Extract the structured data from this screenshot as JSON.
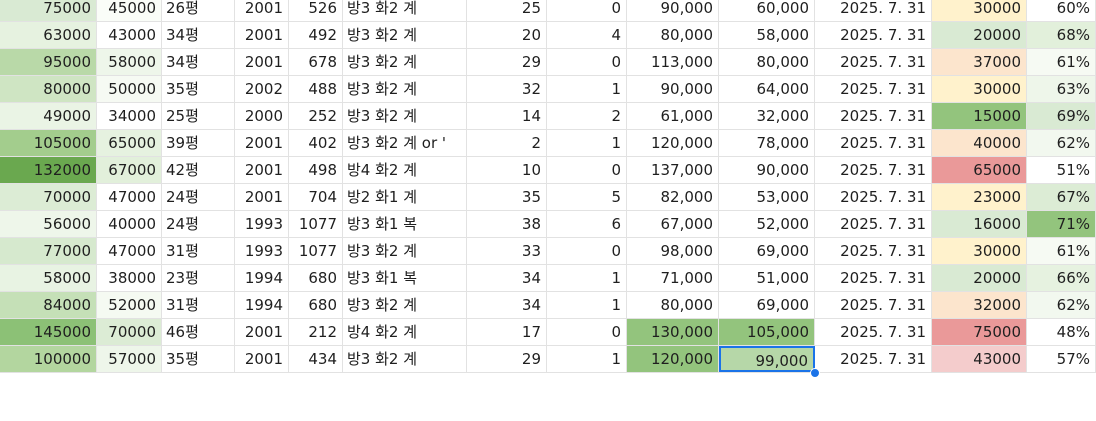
{
  "sheet": {
    "rows": [
      {
        "a": "75000",
        "b": "45000",
        "c": "26평",
        "d": "2001",
        "e": "526",
        "f": "방3 화2 계",
        "g": "25",
        "h": "0",
        "i": "90,000",
        "j": "60,000",
        "k": "2025. 7. 31",
        "l": "30000",
        "m": "60%"
      },
      {
        "a": "63000",
        "b": "43000",
        "c": "34평",
        "d": "2001",
        "e": "492",
        "f": "방3 화2 계",
        "g": "20",
        "h": "4",
        "i": "80,000",
        "j": "58,000",
        "k": "2025. 7. 31",
        "l": "20000",
        "m": "68%"
      },
      {
        "a": "95000",
        "b": "58000",
        "c": "34평",
        "d": "2001",
        "e": "678",
        "f": "방3 화2 계",
        "g": "29",
        "h": "0",
        "i": "113,000",
        "j": "80,000",
        "k": "2025. 7. 31",
        "l": "37000",
        "m": "61%"
      },
      {
        "a": "80000",
        "b": "50000",
        "c": "35평",
        "d": "2002",
        "e": "488",
        "f": "방3 화2 계",
        "g": "32",
        "h": "1",
        "i": "90,000",
        "j": "64,000",
        "k": "2025. 7. 31",
        "l": "30000",
        "m": "63%"
      },
      {
        "a": "49000",
        "b": "34000",
        "c": "25평",
        "d": "2000",
        "e": "252",
        "f": "방3 화2 계",
        "g": "14",
        "h": "2",
        "i": "61,000",
        "j": "32,000",
        "k": "2025. 7. 31",
        "l": "15000",
        "m": "69%"
      },
      {
        "a": "105000",
        "b": "65000",
        "c": "39평",
        "d": "2001",
        "e": "402",
        "f": "방3 화2 계 or '",
        "g": "2",
        "h": "1",
        "i": "120,000",
        "j": "78,000",
        "k": "2025. 7. 31",
        "l": "40000",
        "m": "62%"
      },
      {
        "a": "132000",
        "b": "67000",
        "c": "42평",
        "d": "2001",
        "e": "498",
        "f": "방4 화2 계",
        "g": "10",
        "h": "0",
        "i": "137,000",
        "j": "90,000",
        "k": "2025. 7. 31",
        "l": "65000",
        "m": "51%"
      },
      {
        "a": "70000",
        "b": "47000",
        "c": "24평",
        "d": "2001",
        "e": "704",
        "f": "방2 화1 계",
        "g": "35",
        "h": "5",
        "i": "82,000",
        "j": "53,000",
        "k": "2025. 7. 31",
        "l": "23000",
        "m": "67%"
      },
      {
        "a": "56000",
        "b": "40000",
        "c": "24평",
        "d": "1993",
        "e": "1077",
        "f": "방3 화1 복",
        "g": "38",
        "h": "6",
        "i": "67,000",
        "j": "52,000",
        "k": "2025. 7. 31",
        "l": "16000",
        "m": "71%"
      },
      {
        "a": "77000",
        "b": "47000",
        "c": "31평",
        "d": "1993",
        "e": "1077",
        "f": "방3 화2 계",
        "g": "33",
        "h": "0",
        "i": "98,000",
        "j": "69,000",
        "k": "2025. 7. 31",
        "l": "30000",
        "m": "61%"
      },
      {
        "a": "58000",
        "b": "38000",
        "c": "23평",
        "d": "1994",
        "e": "680",
        "f": "방3 화1 복",
        "g": "34",
        "h": "1",
        "i": "71,000",
        "j": "51,000",
        "k": "2025. 7. 31",
        "l": "20000",
        "m": "66%"
      },
      {
        "a": "84000",
        "b": "52000",
        "c": "31평",
        "d": "1994",
        "e": "680",
        "f": "방3 화2 계",
        "g": "34",
        "h": "1",
        "i": "80,000",
        "j": "69,000",
        "k": "2025. 7. 31",
        "l": "32000",
        "m": "62%"
      },
      {
        "a": "145000",
        "b": "70000",
        "c": "46평",
        "d": "2001",
        "e": "212",
        "f": "방4 화2 계",
        "g": "17",
        "h": "0",
        "i": "130,000",
        "j": "105,000",
        "k": "2025. 7. 31",
        "l": "75000",
        "m": "48%"
      },
      {
        "a": "100000",
        "b": "57000",
        "c": "35평",
        "d": "2001",
        "e": "434",
        "f": "방3 화2 계",
        "g": "29",
        "h": "1",
        "i": "120,000",
        "j": "99,000",
        "k": "2025. 7. 31",
        "l": "43000",
        "m": "57%"
      }
    ],
    "colors": {
      "a": [
        "#d9ead3",
        "#e6f2e0",
        "#b9d9a8",
        "#cfe5c3",
        "#eaf4e5",
        "#a3cd8d",
        "#6aa84f",
        "#dcecd5",
        "#eef6ea",
        "#d6e9ce",
        "#e8f3e3",
        "#c5e0b7",
        "#8cc176",
        "#b3d69f"
      ],
      "b": [
        "#fafdf8",
        "#ffffff",
        "#eef6ea",
        "#f6faf3",
        "#ffffff",
        "#e6f2e0",
        "#e2f0db",
        "#ffffff",
        "#ffffff",
        "#ffffff",
        "#ffffff",
        "#f5faf2",
        "#dcecd5",
        "#eef6ea"
      ],
      "i": [
        "#ffffff",
        "#ffffff",
        "#ffffff",
        "#ffffff",
        "#ffffff",
        "#ffffff",
        "#ffffff",
        "#ffffff",
        "#ffffff",
        "#ffffff",
        "#ffffff",
        "#ffffff",
        "#93c47d",
        "#93c47d"
      ],
      "j": [
        "#ffffff",
        "#ffffff",
        "#ffffff",
        "#ffffff",
        "#ffffff",
        "#ffffff",
        "#ffffff",
        "#ffffff",
        "#ffffff",
        "#ffffff",
        "#ffffff",
        "#ffffff",
        "#93c47d",
        "#b6d7a8"
      ],
      "l": [
        "#fff2cc",
        "#d9ead3",
        "#fce5cd",
        "#fff2cc",
        "#93c47d",
        "#fce5cd",
        "#ea9999",
        "#fff2cc",
        "#d9ead3",
        "#fff2cc",
        "#d9ead3",
        "#fce5cd",
        "#ea9999",
        "#f4cccc"
      ],
      "m": [
        "#ffffff",
        "#e2f0db",
        "#f6faf3",
        "#eef6ea",
        "#d9ead3",
        "#f2f8ef",
        "#ffffff",
        "#dcecd5",
        "#93c47d",
        "#f6faf3",
        "#e6f2e0",
        "#f2f8ef",
        "#ffffff",
        "#ffffff"
      ]
    },
    "selection": {
      "row": 13,
      "col": "j"
    }
  }
}
